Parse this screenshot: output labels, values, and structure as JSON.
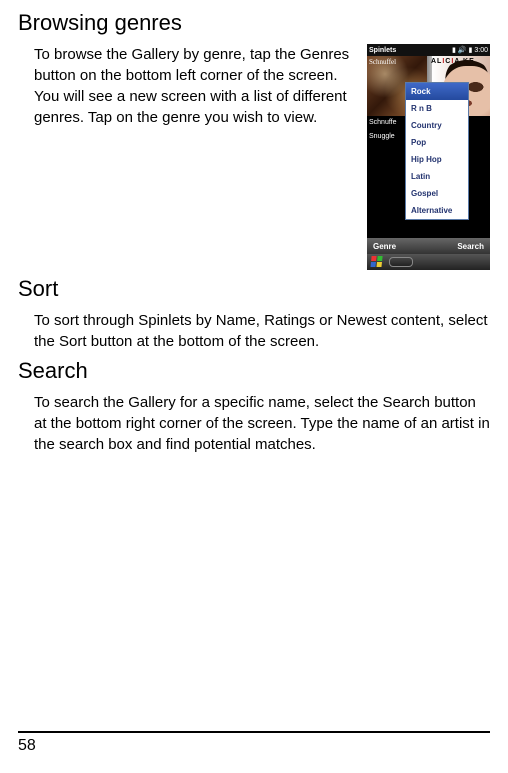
{
  "heading_genres": "Browsing genres",
  "text_genres": "To browse the Gallery by genre, tap the Genres button on the bottom left corner of the screen. You will see a new screen with a list of different genres. Tap on the genre you wish to view.",
  "heading_sort": "Sort",
  "text_sort": "To sort through Spinlets by Name, Ratings or Newest content, select the Sort button at the bottom of the screen.",
  "heading_search": "Search",
  "text_search": "To search the Gallery for a specific name, select the Search button at the bottom right corner of the screen. Type the name of an artist in the search box and find potential matches.",
  "page_number": "58",
  "phone": {
    "status_title": "Spinlets",
    "status_time": "3:00",
    "album_left_label": "Schnuffel",
    "album_right_logo_parts": [
      "AL",
      "I",
      "C",
      "I",
      "A KE"
    ],
    "side_items": [
      "Schnuffe",
      "Snuggle"
    ],
    "genres": [
      "Rock",
      "R n B",
      "Country",
      "Pop",
      "Hip Hop",
      "Latin",
      "Gospel",
      "Alternative"
    ],
    "selected_genre_index": 0,
    "softkey_left": "Genre",
    "softkey_right": "Search"
  }
}
